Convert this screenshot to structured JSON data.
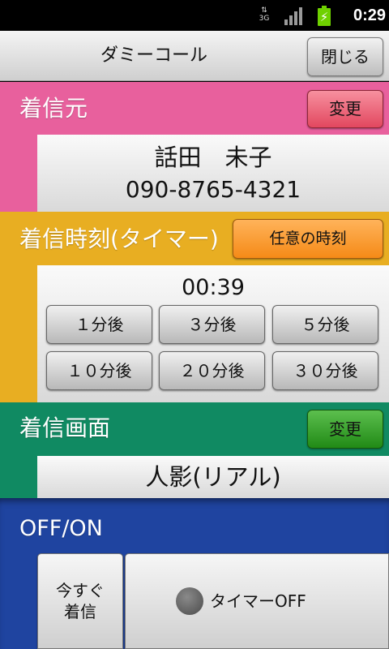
{
  "status_bar": {
    "network": "3G",
    "time": "0:29",
    "battery_color": "#6fd100"
  },
  "header": {
    "title": "ダミーコール",
    "close_label": "閉じる"
  },
  "caller": {
    "title": "着信元",
    "change_label": "変更",
    "name": "話田　未子",
    "number": "090-8765-4321",
    "color": "#e8609d"
  },
  "timer": {
    "title": "着信時刻(タイマー)",
    "any_time_label": "任意の時刻",
    "value": "00:39",
    "buttons": [
      "１分後",
      "３分後",
      "５分後",
      "１０分後",
      "２０分後",
      "３０分後"
    ],
    "color": "#e8ae22"
  },
  "screen": {
    "title": "着信画面",
    "change_label": "変更",
    "value": "人影(リアル)",
    "color": "#108a62"
  },
  "offon": {
    "title": "OFF/ON",
    "now_line1": "今すぐ",
    "now_line2": "着信",
    "timer_label": "タイマーOFF",
    "color": "#1f44a0"
  }
}
